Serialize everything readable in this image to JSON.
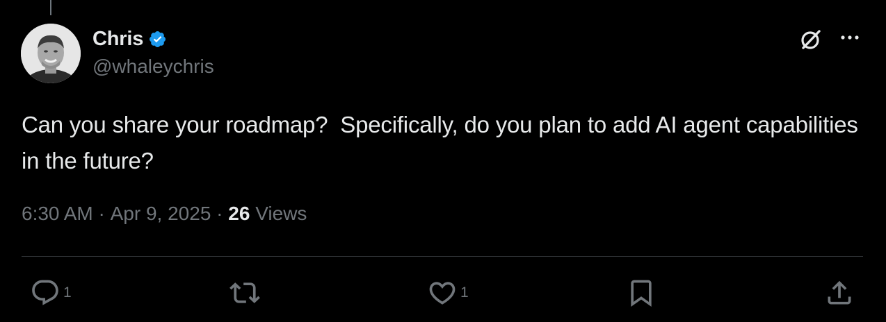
{
  "author": {
    "display_name": "Chris",
    "handle": "@whaleychris",
    "verified": true
  },
  "tweet": {
    "text": "Can you share your roadmap?  Specifically, do you plan to add AI agent capabilities in the future?",
    "time": "6:30 AM",
    "separator": " · ",
    "date": "Apr 9, 2025",
    "views_count": "26",
    "views_label": " Views"
  },
  "actions": {
    "reply_count": "1",
    "retweet_count": "",
    "like_count": "1"
  },
  "icons": {
    "verified": "verified-badge-icon",
    "grok": "grok-icon",
    "more": "more-dots-icon",
    "reply": "reply-bubble-icon",
    "retweet": "retweet-arrows-icon",
    "like": "heart-icon",
    "bookmark": "bookmark-icon",
    "share": "share-upload-icon"
  },
  "colors": {
    "background": "#000000",
    "text_primary": "#e7e9ea",
    "text_secondary": "#71767b",
    "verified_blue": "#1d9bf0",
    "divider": "#2f3336"
  }
}
